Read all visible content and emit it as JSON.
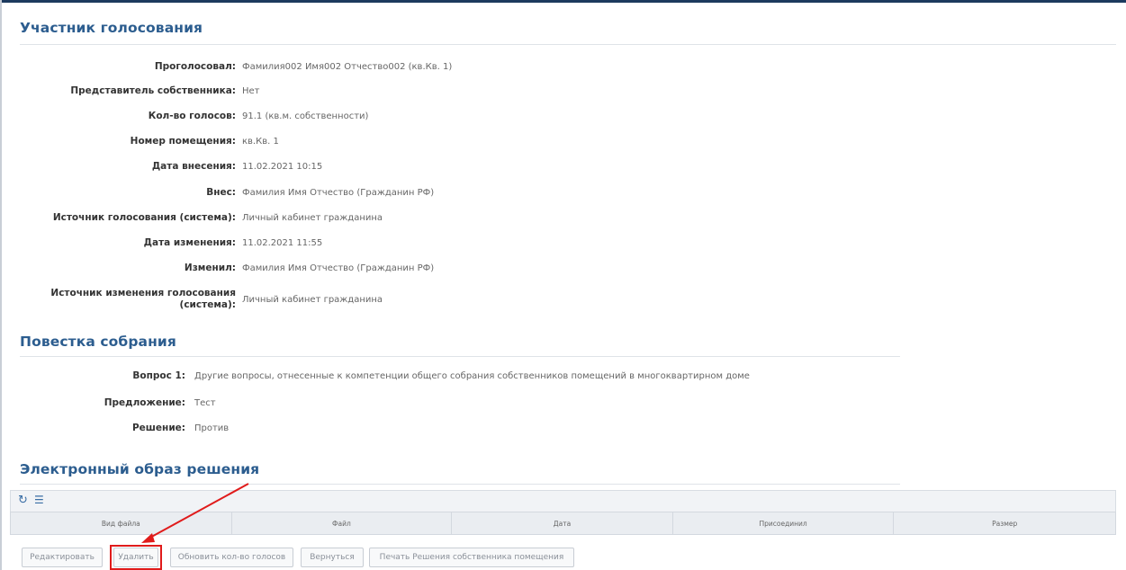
{
  "sections": {
    "voter_title": "Участник голосования",
    "agenda_title": "Повестка собрания",
    "image_title": "Электронный образ решения"
  },
  "voter": {
    "voted_label": "Проголосовал:",
    "voted_value": "Фамилия002 Имя002 Отчество002 (кв.Кв. 1)",
    "representative_label": "Представитель собственника:",
    "representative_value": "Нет",
    "votes_label": "Кол-во голосов:",
    "votes_value": "91.1  (кв.м. собственности)",
    "room_label": "Номер помещения:",
    "room_value": "кв.Кв. 1",
    "entry_date_label": "Дата внесения:",
    "entry_date_value": "11.02.2021 10:15",
    "entered_by_label": "Внес:",
    "entered_by_value": "Фамилия Имя Отчество (Гражданин РФ)",
    "source_label": "Источник голосования (система):",
    "source_value": "Личный кабинет гражданина",
    "change_date_label": "Дата изменения:",
    "change_date_value": "11.02.2021 11:55",
    "changed_by_label": "Изменил:",
    "changed_by_value": "Фамилия Имя Отчество (Гражданин РФ)",
    "change_source_label_1": "Источник изменения голосования",
    "change_source_label_2": "(система):",
    "change_source_value": "Личный кабинет гражданина"
  },
  "agenda": {
    "question_label": "Вопрос 1:",
    "question_value": "Другие вопросы, отнесенные к компетенции общего собрания собственников помещений в многоквартирном доме",
    "proposal_label": "Предложение:",
    "proposal_value": "Тест",
    "decision_label": "Решение:",
    "decision_value": "Против"
  },
  "grid": {
    "refresh_icon": "refresh-icon",
    "columns_icon": "columns-icon",
    "refresh_glyph": "↻",
    "columns_glyph": "☰",
    "headers": [
      "Вид файла",
      "Файл",
      "Дата",
      "Присоединил",
      "Размер"
    ]
  },
  "buttons": {
    "edit": "Редактировать",
    "delete": "Удалить",
    "update_votes": "Обновить кол-во голосов",
    "back": "Вернуться",
    "print": "Печать Решения собственника помещения"
  },
  "colors": {
    "accent": "#2c5d8f",
    "annotation": "#e01b1b"
  }
}
